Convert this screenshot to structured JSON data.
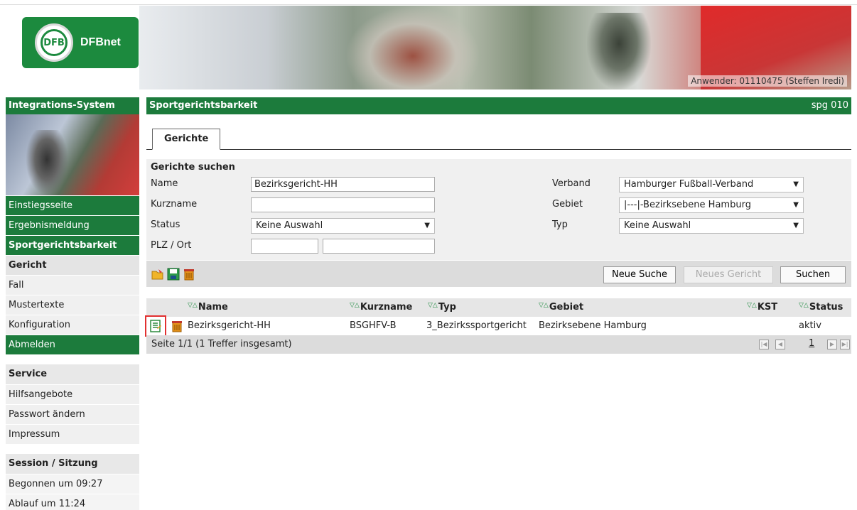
{
  "header": {
    "logo_text": "DFBnet",
    "logo_mark": "DFB",
    "user_label": "Anwender: 01110475 (Steffen Iredi)"
  },
  "sidebar": {
    "title": "Integrations-System",
    "items": [
      {
        "label": "Einstiegsseite"
      },
      {
        "label": "Ergebnismeldung"
      },
      {
        "label": "Sportgerichtsbarkeit"
      },
      {
        "label": "Gericht"
      },
      {
        "label": "Fall"
      },
      {
        "label": "Mustertexte"
      },
      {
        "label": "Konfiguration"
      },
      {
        "label": "Abmelden"
      }
    ],
    "service": {
      "title": "Service",
      "items": [
        {
          "label": "Hilfsangebote"
        },
        {
          "label": "Passwort ändern"
        },
        {
          "label": "Impressum"
        }
      ]
    },
    "session": {
      "title": "Session / Sitzung",
      "begun": "Begonnen um 09:27",
      "expires": "Ablauf um 11:24"
    }
  },
  "main": {
    "title": "Sportgerichtsbarkeit",
    "code": "spg 010",
    "tab": "Gerichte",
    "search": {
      "title": "Gerichte suchen",
      "name_label": "Name",
      "name_value": "Bezirksgericht-HH",
      "kurzname_label": "Kurzname",
      "kurzname_value": "",
      "status_label": "Status",
      "status_value": "Keine Auswahl",
      "plz_label": "PLZ / Ort",
      "plz_value": "",
      "ort_value": "",
      "verband_label": "Verband",
      "verband_value": "Hamburger Fußball-Verband",
      "gebiet_label": "Gebiet",
      "gebiet_value": "|---|-Bezirksebene Hamburg",
      "typ_label": "Typ",
      "typ_value": "Keine Auswahl"
    },
    "toolbar": {
      "neue_suche": "Neue Suche",
      "neues_gericht": "Neues Gericht",
      "suchen": "Suchen"
    },
    "table": {
      "sort_glyph": "▽△",
      "columns": [
        "Name",
        "Kurzname",
        "Typ",
        "Gebiet",
        "KST",
        "Status"
      ],
      "rows": [
        {
          "name": "Bezirksgericht-HH",
          "kurzname": "BSGHFV-B",
          "typ": "3_Bezirkssportgericht",
          "gebiet": "Bezirksebene Hamburg",
          "kst": "",
          "status": "aktiv"
        }
      ],
      "footer": "Seite 1/1 (1 Treffer insgesamt)",
      "page": "1"
    }
  },
  "icons": {
    "toolbar": [
      "open-folder-icon",
      "save-icon",
      "delete-icon"
    ],
    "row": [
      "edit-icon",
      "delete-icon"
    ]
  },
  "colors": {
    "brand_green": "#1c7b3c",
    "highlight_red": "#e23030"
  }
}
